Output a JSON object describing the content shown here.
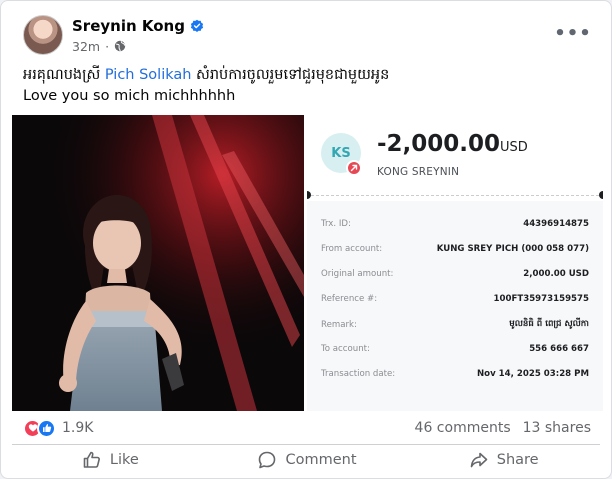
{
  "post": {
    "author": "Sreynin Kong",
    "time": "32m",
    "separator": "·",
    "text_line1_before": "អរគុណបងស្រី ",
    "tagged_name": "Pich Solikah",
    "text_line1_after": " សំរាប់ការចូលរួមទៅជួរមុខជាមួយអូន",
    "text_line2": "Love you so mich michhhhhh"
  },
  "receipt": {
    "initials": "KS",
    "amount": "-2,000.00",
    "currency": "USD",
    "payee": "KONG SREYNIN",
    "rows": [
      {
        "label": "Trx. ID:",
        "value": "44396914875"
      },
      {
        "label": "From account:",
        "value": "KUNG SREY PICH (000 058 077)"
      },
      {
        "label": "Original amount:",
        "value": "2,000.00 USD"
      },
      {
        "label": "Reference #:",
        "value": "100FT35973159575"
      },
      {
        "label": "Remark:",
        "value": "មូលនិធិ ពី ពេជ្រ សូលីកា"
      },
      {
        "label": "To account:",
        "value": "556 666 667"
      },
      {
        "label": "Transaction date:",
        "value": "Nov 14, 2025 03:28 PM"
      }
    ]
  },
  "stats": {
    "reactions": "1.9K",
    "comments": "46 comments",
    "shares": "13 shares"
  },
  "actions": {
    "like": "Like",
    "comment": "Comment",
    "share": "Share"
  },
  "icons": {
    "verified": "verified-badge-icon",
    "privacy": "globe-icon",
    "more": "more-options-icon",
    "love": "love-reaction-icon",
    "like": "like-reaction-icon"
  },
  "colors": {
    "accent": "#1877f2",
    "tag": "#216fdb",
    "love": "#f33e58",
    "debit": "#e84855",
    "ks_bg": "#d7eff1"
  }
}
